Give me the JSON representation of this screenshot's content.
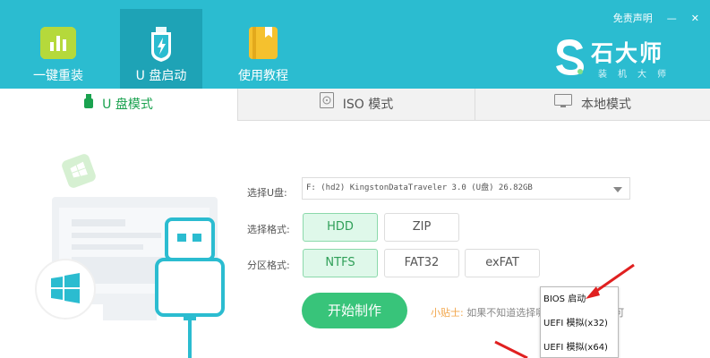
{
  "nav": {
    "items": [
      {
        "label": "一键重装"
      },
      {
        "label": "U 盘启动"
      },
      {
        "label": "使用教程"
      }
    ]
  },
  "header": {
    "disclaimer": "免责声明",
    "minimize": "—",
    "close": "✕",
    "brand_name": "石大师",
    "brand_sub": "装机大师"
  },
  "tabs": [
    {
      "label": "U 盘模式"
    },
    {
      "label": "ISO 模式"
    },
    {
      "label": "本地模式"
    }
  ],
  "form": {
    "usb_label": "选择U盘:",
    "usb_value": "F: (hd2) KingstonDataTraveler 3.0 (U盘) 26.82GB",
    "format_label": "选择格式:",
    "format_options": [
      "HDD",
      "ZIP"
    ],
    "format_selected": "HDD",
    "partition_label": "分区格式:",
    "partition_options": [
      "NTFS",
      "FAT32",
      "exFAT"
    ],
    "partition_selected": "NTFS"
  },
  "actions": {
    "start_label": "开始制作"
  },
  "tip": {
    "label": "小贴士:",
    "text": "如果不知道选择哪个请选择默认即可"
  },
  "popup": {
    "items": [
      "BIOS 启动",
      "UEFI 模拟(x32)",
      "UEFI 模拟(x64)"
    ]
  },
  "colors": {
    "header_bg": "#2bbcd0",
    "active_nav_bg": "#1ea3b6",
    "accent_green": "#38c47a",
    "tab_active_text": "#1aa24f",
    "annotation_red": "#e02020"
  },
  "icons": {
    "nav": [
      "chart-icon",
      "usb-shield-icon",
      "book-icon"
    ],
    "tabs": [
      "usb-icon",
      "disc-icon",
      "monitor-icon"
    ],
    "illustration": [
      "windows-logo-icon",
      "usb-plug-icon"
    ]
  }
}
